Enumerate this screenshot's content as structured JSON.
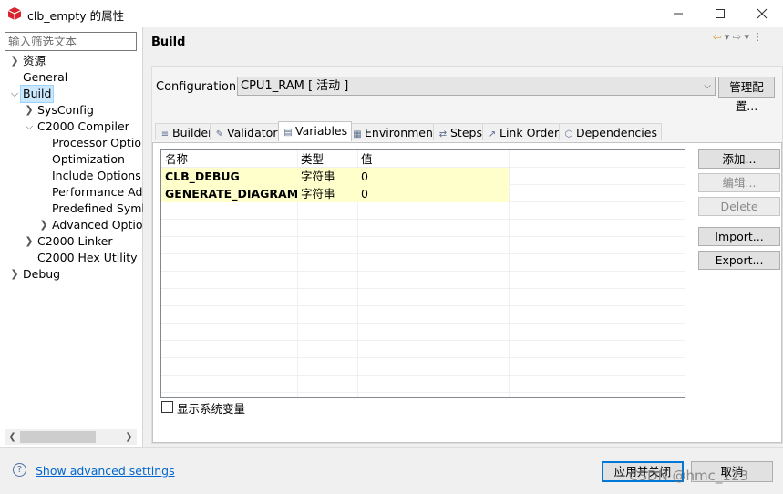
{
  "window": {
    "title": "clb_empty 的属性",
    "icon": "package-icon",
    "controls": [
      "minimize-icon",
      "maximize-icon",
      "close-icon"
    ]
  },
  "sidebar": {
    "filter_placeholder": "输入筛选文本",
    "tree": [
      {
        "label": "资源",
        "twisty": "collapsed"
      },
      {
        "label": "General",
        "twisty": "none"
      },
      {
        "label": "Build",
        "twisty": "expanded",
        "selected": true
      },
      {
        "label": "SysConfig",
        "twisty": "collapsed"
      },
      {
        "label": "C2000 Compiler",
        "twisty": "expanded"
      },
      {
        "label": "Processor Optio",
        "twisty": "none"
      },
      {
        "label": "Optimization",
        "twisty": "none"
      },
      {
        "label": "Include Options",
        "twisty": "none"
      },
      {
        "label": "Performance Ad",
        "twisty": "none"
      },
      {
        "label": "Predefined Syml",
        "twisty": "none"
      },
      {
        "label": "Advanced Optio",
        "twisty": "collapsed"
      },
      {
        "label": "C2000 Linker",
        "twisty": "collapsed"
      },
      {
        "label": "C2000 Hex Utility",
        "twisty": "none"
      },
      {
        "label": "Debug",
        "twisty": "collapsed"
      }
    ]
  },
  "main": {
    "title": "Build",
    "configuration": {
      "label": "Configuration:",
      "value": "CPU1_RAM  [ 活动 ]",
      "manage_label": "管理配置..."
    },
    "tabs": [
      {
        "label": "Builder",
        "icon": "builder-icon"
      },
      {
        "label": "Validator",
        "icon": "validator-icon"
      },
      {
        "label": "Variables",
        "icon": "variables-icon",
        "active": true
      },
      {
        "label": "Environment",
        "icon": "environment-icon"
      },
      {
        "label": "Steps",
        "icon": "steps-icon"
      },
      {
        "label": "Link Order",
        "icon": "link-order-icon"
      },
      {
        "label": "Dependencies",
        "icon": "dependencies-icon"
      }
    ],
    "table": {
      "columns": [
        "名称",
        "类型",
        "值"
      ],
      "rows": [
        [
          "CLB_DEBUG",
          "字符串",
          "0"
        ],
        [
          "GENERATE_DIAGRAM",
          "字符串",
          "0"
        ]
      ]
    },
    "side_buttons": [
      {
        "label": "添加...",
        "enabled": true
      },
      {
        "label": "编辑...",
        "enabled": false
      },
      {
        "label": "Delete",
        "enabled": false
      },
      {
        "label": "Import...",
        "enabled": true
      },
      {
        "label": "Export...",
        "enabled": true
      }
    ],
    "show_system_vars": {
      "label": "显示系统变量",
      "checked": false
    }
  },
  "footer": {
    "advanced_link": "Show advanced settings",
    "apply_close": "应用并关闭",
    "cancel": "取消",
    "watermark": "CSDN @hmc_123"
  },
  "colors": {
    "highlight_row": "#ffffcc",
    "selected_item": "#cce8ff",
    "link": "#0066cc",
    "focus": "#0078d7"
  }
}
